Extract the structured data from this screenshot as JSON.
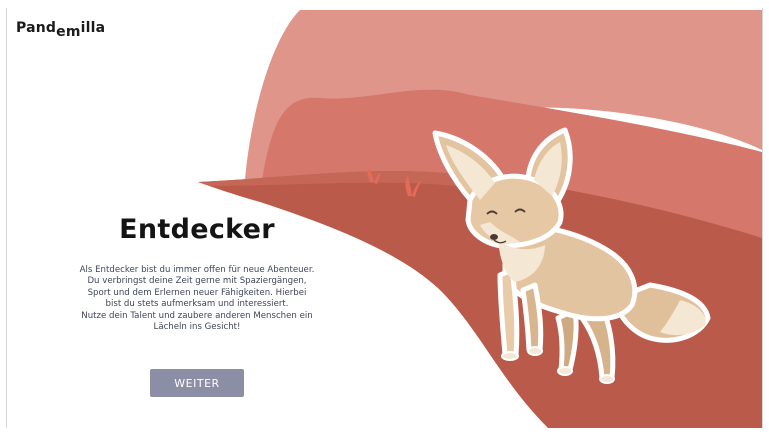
{
  "brand": {
    "name_part1": "Pand",
    "name_part2": "em",
    "name_part3": "illa"
  },
  "main": {
    "title": "Entdecker",
    "description_lines": [
      "Als Entdecker bist du immer offen für neue Abenteuer.",
      "Du verbringst deine Zeit gerne mit Spaziergängen,",
      "Sport und dem Erlernen neuer Fähigkeiten. Hierbei",
      "bist du stets aufmerksam und interessiert.",
      "Nutze dein Talent und zaubere anderen Menschen ein",
      "Lächeln ins Gesicht!"
    ],
    "button_label": "WEITER"
  },
  "colors": {
    "hill_back": "#df958a",
    "hill_mid": "#d5776b",
    "hill_front": "#b95a4a",
    "button": "#8b8ea5",
    "fox_fur": "#e3c4a0",
    "fox_light": "#f4e7d3"
  }
}
